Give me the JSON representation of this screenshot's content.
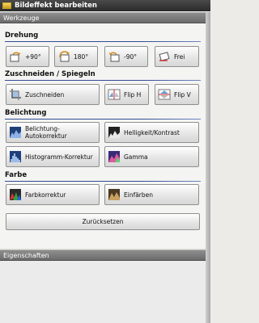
{
  "window": {
    "title": "Bildeffekt bearbeiten"
  },
  "panels": {
    "tools_title": "Werkzeuge",
    "properties_title": "Eigenschaften"
  },
  "sections": {
    "rotation": {
      "title": "Drehung",
      "buttons": [
        {
          "label": "+90°",
          "icon": "rotate-cw-icon"
        },
        {
          "label": "180°",
          "icon": "rotate-180-icon"
        },
        {
          "label": "-90°",
          "icon": "rotate-ccw-icon"
        },
        {
          "label": "Frei",
          "icon": "free-rotate-icon"
        }
      ]
    },
    "crop_mirror": {
      "title": "Zuschneiden / Spiegeln",
      "buttons": [
        {
          "label": "Zuschneiden",
          "icon": "crop-icon"
        },
        {
          "label": "Flip H",
          "icon": "flip-horizontal-icon"
        },
        {
          "label": "Flip V",
          "icon": "flip-vertical-icon"
        }
      ]
    },
    "exposure": {
      "title": "Belichtung",
      "buttons": [
        {
          "label": "Belichtung-Autokorrektur",
          "icon": "auto-exposure-icon"
        },
        {
          "label": "Helligkeit/Kontrast",
          "icon": "brightness-contrast-icon"
        },
        {
          "label": "Histogramm-Korrektur",
          "icon": "histogram-icon"
        },
        {
          "label": "Gamma",
          "icon": "gamma-icon"
        }
      ]
    },
    "color": {
      "title": "Farbe",
      "buttons": [
        {
          "label": "Farbkorrektur",
          "icon": "color-correction-icon"
        },
        {
          "label": "Einfärben",
          "icon": "colorize-icon"
        }
      ]
    }
  },
  "reset_label": "Zurücksetzen"
}
